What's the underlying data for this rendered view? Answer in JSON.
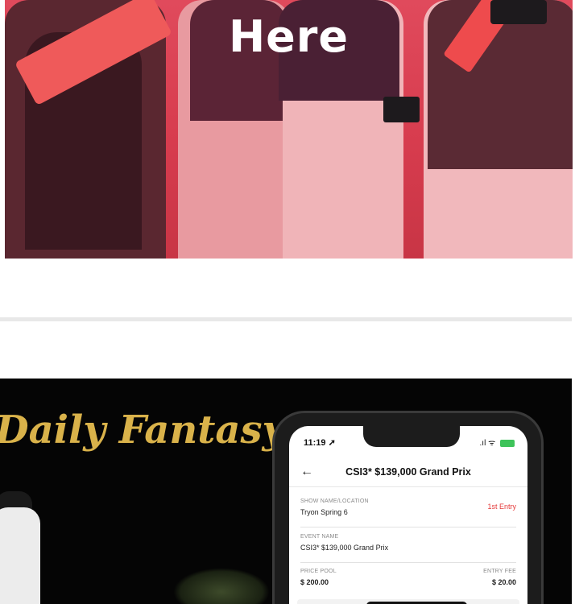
{
  "hero": {
    "title": "Here"
  },
  "promo": {
    "title": "Daily Fantasy",
    "phone": {
      "status_time": "11:19 ➚",
      "status_icons": ".ıl ᯤ",
      "header_title": "CSI3* $139,000 Grand Prix",
      "show_label": "SHOW NAME/LOCATION",
      "show_value": "Tryon Spring 6",
      "entry_badge": "1st Entry",
      "event_label": "EVENT NAME",
      "event_value": "CSI3* $139,000 Grand Prix",
      "price_label": "PRICE POOL",
      "price_value": "$ 200.00",
      "fee_label": "ENTRY FEE",
      "fee_value": "$ 20.00"
    }
  },
  "colors": {
    "accent_red": "#e04a5c",
    "gold": "#d9b24a",
    "fee_green": "#2faa4a",
    "entry_red": "#e53a3a"
  }
}
